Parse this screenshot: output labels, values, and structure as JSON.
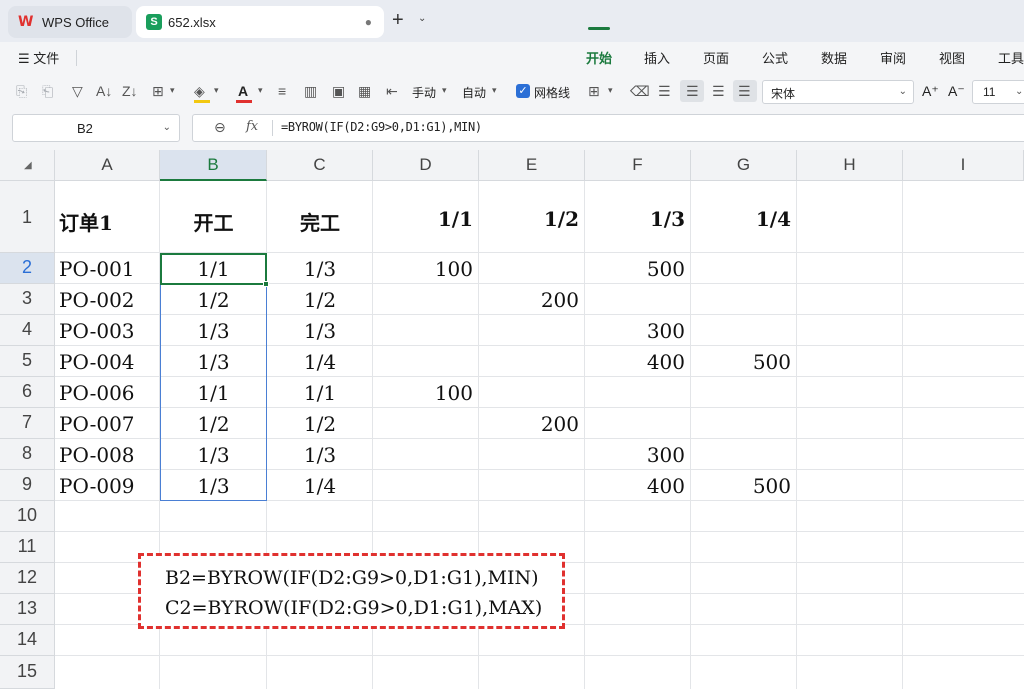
{
  "tabs": {
    "wps": "WPS Office",
    "file": "652.xlsx",
    "file_dot": "●",
    "new_tab": "+",
    "new_tab_arrow": "⌄"
  },
  "menubar": {
    "file_icon": "☰",
    "file_label": "文件",
    "tabs": [
      "开始",
      "插入",
      "页面",
      "公式",
      "数据",
      "审阅",
      "视图",
      "工具"
    ],
    "active_tab": "开始"
  },
  "toolbar": {
    "manual_label": "手动",
    "auto_label": "自动",
    "gridlines_label": "网格线",
    "gridlines_checked": true,
    "font_name": "宋体",
    "font_size": "11",
    "font_color": "#e0312f",
    "highlight_color": "#f2c811"
  },
  "formula_bar": {
    "cell_ref": "B2",
    "fx_label": "fx",
    "formula": "=BYROW(IF(D2:G9>0,D1:G1),MIN)"
  },
  "sheet": {
    "columns": [
      "A",
      "B",
      "C",
      "D",
      "E",
      "F",
      "G",
      "H",
      "I"
    ],
    "rows": [
      "1",
      "2",
      "3",
      "4",
      "5",
      "6",
      "7",
      "8",
      "9",
      "10",
      "11",
      "12",
      "13",
      "14",
      "15"
    ],
    "selected_column": "B",
    "header_row": [
      "订单1",
      "开工",
      "完工",
      "1/1",
      "1/2",
      "1/3",
      "1/4"
    ],
    "data": [
      [
        "PO-001",
        "1/1",
        "1/3",
        "100",
        "",
        "500",
        ""
      ],
      [
        "PO-002",
        "1/2",
        "1/2",
        "",
        "200",
        "",
        ""
      ],
      [
        "PO-003",
        "1/3",
        "1/3",
        "",
        "",
        "300",
        ""
      ],
      [
        "PO-004",
        "1/3",
        "1/4",
        "",
        "",
        "400",
        "500"
      ],
      [
        "PO-006",
        "1/1",
        "1/1",
        "100",
        "",
        "",
        ""
      ],
      [
        "PO-007",
        "1/2",
        "1/2",
        "",
        "200",
        "",
        ""
      ],
      [
        "PO-008",
        "1/3",
        "1/3",
        "",
        "",
        "300",
        ""
      ],
      [
        "PO-009",
        "1/3",
        "1/4",
        "",
        "",
        "400",
        "500"
      ]
    ]
  },
  "note": {
    "line1": "B2=BYROW(IF(D2:G9>0,D1:G1),MIN)",
    "line2": "C2=BYROW(IF(D2:G9>0,D1:G1),MAX)",
    "border_color": "#e0312f"
  }
}
